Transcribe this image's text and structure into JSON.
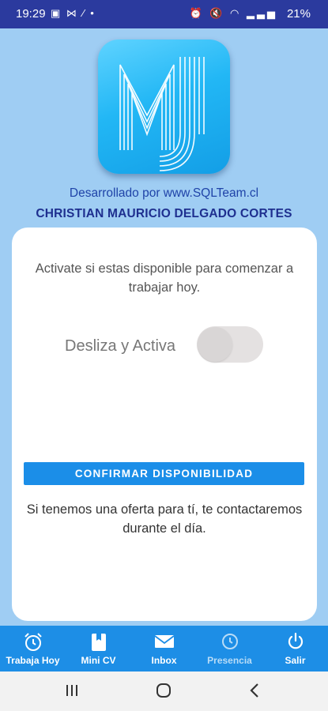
{
  "status_bar": {
    "time": "19:29",
    "left_icons": "▣ ⋈ ⁄ •",
    "right_icons": "⏰ 🔇 ◠ ▂▃▅",
    "battery": "21%"
  },
  "header": {
    "developer_text": "Desarrollado por www.SQLTeam.cl",
    "user_name": "CHRISTIAN MAURICIO DELGADO CORTES"
  },
  "card": {
    "prompt": "Activate si estas disponible para comenzar a trabajar hoy.",
    "toggle_label": "Desliza y Activa",
    "toggle_on": false,
    "confirm_button": "CONFIRMAR DISPONIBILIDAD",
    "info_text": "Si tenemos una oferta para tí, te contactaremos durante el día."
  },
  "bottom_nav": {
    "items": [
      {
        "label": "Trabaja Hoy",
        "icon": "alarm-clock-icon"
      },
      {
        "label": "Mini CV",
        "icon": "document-icon"
      },
      {
        "label": "Inbox",
        "icon": "mail-icon"
      },
      {
        "label": "Presencia",
        "icon": "clock-icon"
      },
      {
        "label": "Salir",
        "icon": "power-icon"
      }
    ]
  },
  "colors": {
    "background": "#9fcdf3",
    "status_bar": "#2b3a9e",
    "primary": "#1d8ee6",
    "title_blue": "#1e2f8f"
  }
}
